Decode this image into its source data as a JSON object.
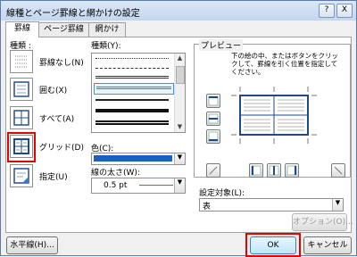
{
  "window": {
    "title": "線種とページ罫線と網かけの設定",
    "help_label": "?",
    "close_label": "X"
  },
  "tabs": [
    {
      "label": "罫線",
      "active": true
    },
    {
      "label": "ページ罫線",
      "active": false
    },
    {
      "label": "網かけ",
      "active": false
    }
  ],
  "setting": {
    "heading": "種類 :",
    "items": [
      {
        "label": "罫線なし(N)",
        "icon": "no-border-icon"
      },
      {
        "label": "囲む(X)",
        "icon": "box-border-icon"
      },
      {
        "label": "すべて(A)",
        "icon": "all-borders-icon"
      },
      {
        "label": "グリッド(D)",
        "icon": "grid-border-icon",
        "highlighted": true
      },
      {
        "label": "指定(U)",
        "icon": "custom-border-icon"
      }
    ]
  },
  "style": {
    "heading": "種類(Y):",
    "color_label": "色(C):",
    "color_value": "#1f5fbf",
    "width_label": "線の太さ(W):",
    "width_value": "0.5 pt"
  },
  "preview": {
    "heading": "プレビュー",
    "instruction": "下の絵の中、またはボタンをクリックして、罫線を引く位置を指定してください。",
    "apply_label": "設定対象(L):",
    "apply_value": "表",
    "options_label": "オプション(O)..."
  },
  "footer": {
    "horizontal_line_label": "水平線(H)...",
    "ok_label": "OK",
    "cancel_label": "キャンセル"
  },
  "colors": {
    "highlight": "#e60000",
    "selection": "#3399ff"
  }
}
